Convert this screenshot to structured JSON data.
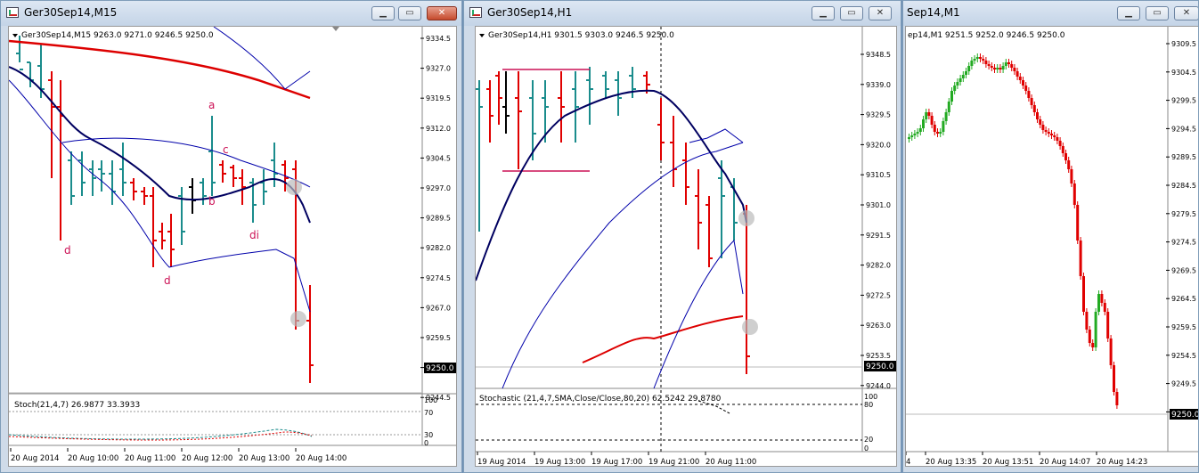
{
  "windows": [
    {
      "title": "Ger30Sep14,M15",
      "header": "Ger30Sep14,M15  9263.0 9271.0 9246.5 9250.0",
      "yticks": [
        "9334.5",
        "9327.0",
        "9319.5",
        "9312.0",
        "9304.5",
        "9297.0",
        "9289.5",
        "9282.0",
        "9274.5",
        "9267.0",
        "9259.5",
        "9252.0",
        "9244.5"
      ],
      "price_tag": "9250.0",
      "xticks": [
        "20 Aug 2014",
        "20 Aug 10:00",
        "20 Aug 11:00",
        "20 Aug 12:00",
        "20 Aug 13:00",
        "20 Aug 14:00"
      ],
      "annotations": [
        "a",
        "c",
        "b",
        "d",
        "d",
        "di"
      ],
      "sub_label": "Stoch(21,4,7) 26.9877 33.3933",
      "sub_ticks": [
        "100",
        "70",
        "30",
        "0"
      ]
    },
    {
      "title": "Ger30Sep14,H1",
      "header": "Ger30Sep14,H1  9301.5 9303.0 9246.5 9250.0",
      "yticks": [
        "9348.5",
        "9339.0",
        "9329.5",
        "9320.0",
        "9310.5",
        "9301.0",
        "9291.5",
        "9282.0",
        "9272.5",
        "9263.0",
        "9253.5",
        "9244.0"
      ],
      "price_tag": "9250.0",
      "xticks": [
        "19 Aug 2014",
        "19 Aug 13:00",
        "19 Aug 17:00",
        "19 Aug 21:00",
        "20 Aug 11:00"
      ],
      "sub_label": "Stochastic (21,4,7,SMA,Close/Close,80,20) 62.5242 29.8780",
      "sub_ticks": [
        "100",
        "80",
        "20",
        "0"
      ]
    },
    {
      "title": "Sep14,M1",
      "header": "ep14,M1  9251.5 9252.0 9246.5 9250.0",
      "yticks": [
        "9309.5",
        "9304.5",
        "9299.5",
        "9294.5",
        "9289.5",
        "9284.5",
        "9279.5",
        "9274.5",
        "9269.5",
        "9264.5",
        "9259.5",
        "9254.5",
        "9249.5",
        "9244.5"
      ],
      "price_tag": "9250.0",
      "xticks": [
        "4",
        "20 Aug 13:35",
        "20 Aug 13:51",
        "20 Aug 14:07",
        "20 Aug 14:23"
      ]
    }
  ],
  "colors": {
    "bull": "#1a8c8c",
    "bear": "#e00000",
    "ma_dark": "#000060",
    "ma_red": "#dd0000",
    "band": "#0000aa",
    "m1_bull": "#22aa22"
  }
}
